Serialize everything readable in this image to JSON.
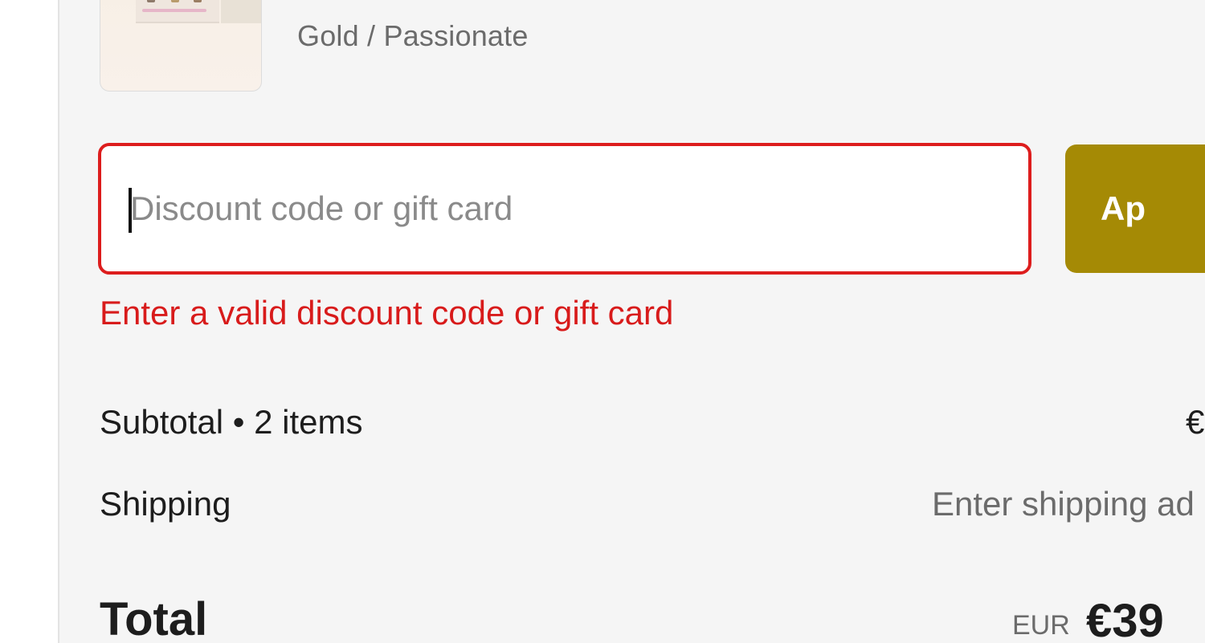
{
  "cart": {
    "item": {
      "variant": "Gold / Passionate",
      "thumbnail_icon": "product-thumbnail"
    }
  },
  "discount": {
    "placeholder": "Discount code or gift card",
    "value": "",
    "apply_label": "Ap",
    "error": "Enter a valid discount code or gift card",
    "error_color": "#d81b1b",
    "accent_color": "#a58a05"
  },
  "summary": {
    "subtotal_label": "Subtotal • 2 items",
    "subtotal_value": "€",
    "shipping_label": "Shipping",
    "shipping_value": "Enter shipping ad",
    "total_label": "Total",
    "currency_code": "EUR",
    "total_value": "€39"
  }
}
